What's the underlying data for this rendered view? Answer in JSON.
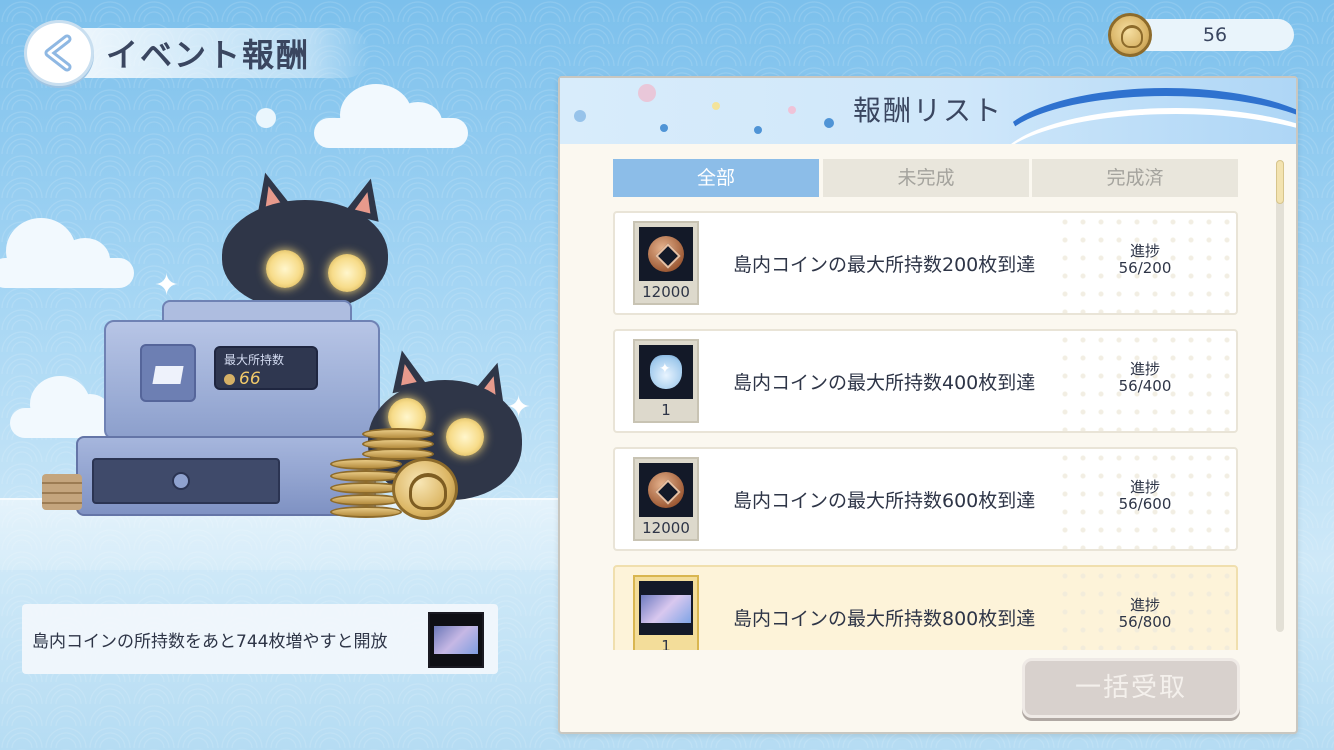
{
  "header": {
    "title": "イベント報酬"
  },
  "currency": {
    "value": "56"
  },
  "illustration": {
    "display_label": "最大所持数",
    "display_value": "66"
  },
  "unlock_hint": {
    "text": "島内コインの所持数をあと744枚増やすと開放"
  },
  "panel": {
    "title": "報酬リスト",
    "tabs": [
      {
        "label": "全部",
        "active": true
      },
      {
        "label": "未完成",
        "active": false
      },
      {
        "label": "完成済",
        "active": false
      }
    ],
    "progress_label": "進捗",
    "rewards": [
      {
        "icon": "coin-icon",
        "quantity": "12000",
        "description": "島内コインの最大所持数200枚到達",
        "progress": "56/200",
        "highlighted": false
      },
      {
        "icon": "pouch-icon",
        "quantity": "1",
        "description": "島内コインの最大所持数400枚到達",
        "progress": "56/400",
        "highlighted": false
      },
      {
        "icon": "coin-icon",
        "quantity": "12000",
        "description": "島内コインの最大所持数600枚到達",
        "progress": "56/600",
        "highlighted": false
      },
      {
        "icon": "picture-icon",
        "quantity": "1",
        "description": "島内コインの最大所持数800枚到達",
        "progress": "56/800",
        "highlighted": true
      }
    ],
    "claim_all_label": "一括受取"
  },
  "colors": {
    "tab_active": "#8cbde8",
    "tab_inactive": "#e9e6dc",
    "claim_disabled": "#d8d1cd",
    "highlight_row": "#fdf3d9"
  }
}
